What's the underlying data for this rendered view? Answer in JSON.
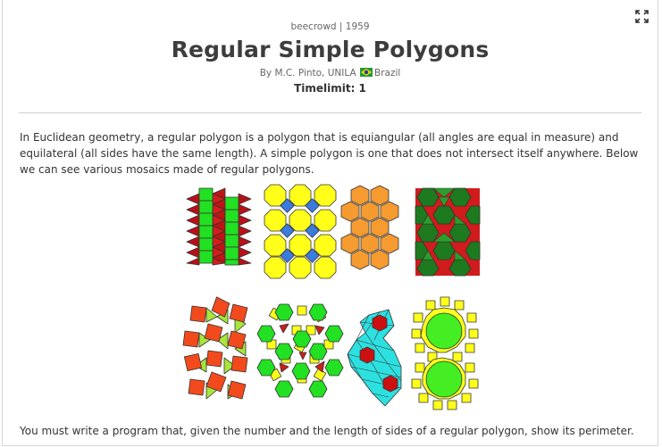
{
  "header": {
    "origin": "beecrowd | 1959",
    "title": "Regular Simple Polygons",
    "author_prefix": "By M.C. Pinto, UNILA",
    "country": "Brazil",
    "timelimit": "Timelimit: 1"
  },
  "icons": {
    "expand": "expand-icon",
    "flag": "brazil-flag-icon"
  },
  "description": {
    "paragraph1": "In Euclidean geometry, a regular polygon is a polygon that is equiangular (all angles are equal in measure) and equilateral (all sides have the same length). A simple polygon is one that does not intersect itself anywhere. Below we can see various mosaics made of regular polygons.",
    "paragraph2": "You must write a program that, given the number and the length of sides of a regular polygon, show its perimeter."
  },
  "figure": {
    "tiles": [
      {
        "name": "mosaic-squares-triangles",
        "colors": [
          "#22dd22",
          "#cc0000"
        ]
      },
      {
        "name": "mosaic-octagons-squares",
        "colors": [
          "#ffff00",
          "#3a7be0"
        ]
      },
      {
        "name": "mosaic-hexagons",
        "colors": [
          "#f59b30"
        ]
      },
      {
        "name": "mosaic-hexagons-triangles",
        "colors": [
          "#1e7a1e",
          "#d01c1c"
        ]
      },
      {
        "name": "mosaic-snub-square",
        "colors": [
          "#f24a1c",
          "#a8e63a"
        ]
      },
      {
        "name": "mosaic-hexagons-squares-triangles",
        "colors": [
          "#22dd22",
          "#ffff00",
          "#d01c1c"
        ]
      },
      {
        "name": "mosaic-cyan-triangles-hexagons",
        "colors": [
          "#2de0e0",
          "#cc1010"
        ]
      },
      {
        "name": "mosaic-dodecagons-squares",
        "colors": [
          "#44ee22",
          "#ffff00"
        ]
      }
    ]
  },
  "colors": {
    "title": "#3d3d3d",
    "text": "#333333",
    "rule": "#cfcfcf"
  }
}
